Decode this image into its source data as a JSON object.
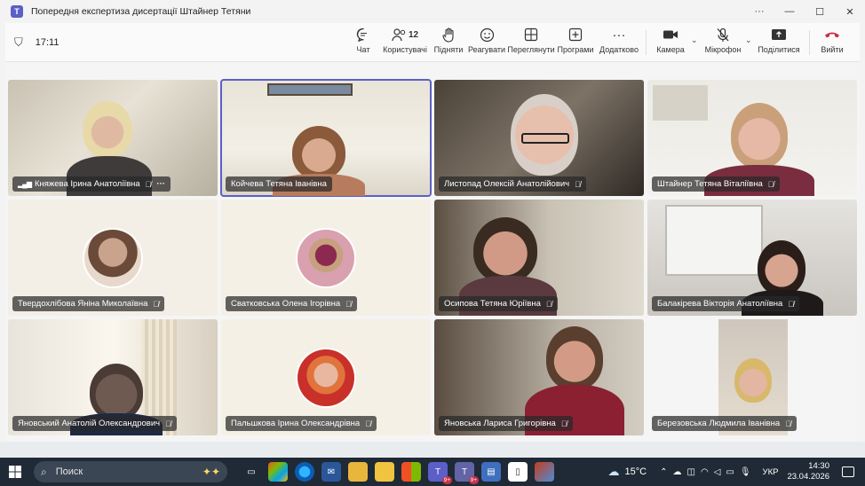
{
  "window": {
    "title": "Попередня експертиза дисертації Штайнер Тетяни",
    "more": "···",
    "minimize": "—",
    "maximize": "☐",
    "close": "✕"
  },
  "toolbar": {
    "timer": "17:11",
    "chat": "Чат",
    "people": "Користувачі",
    "people_count": "12",
    "raise": "Підняти",
    "react": "Реагувати",
    "view": "Переглянути",
    "apps": "Програми",
    "more": "Додатково",
    "camera": "Камера",
    "mic": "Мікрофон",
    "share": "Поділитися",
    "leave": "Вийти"
  },
  "participants": [
    {
      "name": "Княжева Ірина Анатоліївна",
      "speaking": true
    },
    {
      "name": "Койчева Тетяна Іванівна",
      "active": true
    },
    {
      "name": "Листопад Олексій Анатолійович"
    },
    {
      "name": "Штайнер Тетяна Віталіївна"
    },
    {
      "name": "Твердохлібова Янiна Миколаївна"
    },
    {
      "name": "Сватковська Олена Ігорівна"
    },
    {
      "name": "Осипова Тетяна Юріївна"
    },
    {
      "name": "Балакірева Вікторія Анатоліївна"
    },
    {
      "name": "Яновський Анатолій Олександрович"
    },
    {
      "name": "Пальшкова Ірина Олександрівна"
    },
    {
      "name": "Яновська Лариса Григорівна"
    },
    {
      "name": "Березовська Людмила Іванівна"
    }
  ],
  "taskbar": {
    "search_label": "Поиск",
    "temperature": "15°C",
    "language": "УКР",
    "time": "14:30",
    "date": "23.04.2026",
    "badge": "9+"
  }
}
